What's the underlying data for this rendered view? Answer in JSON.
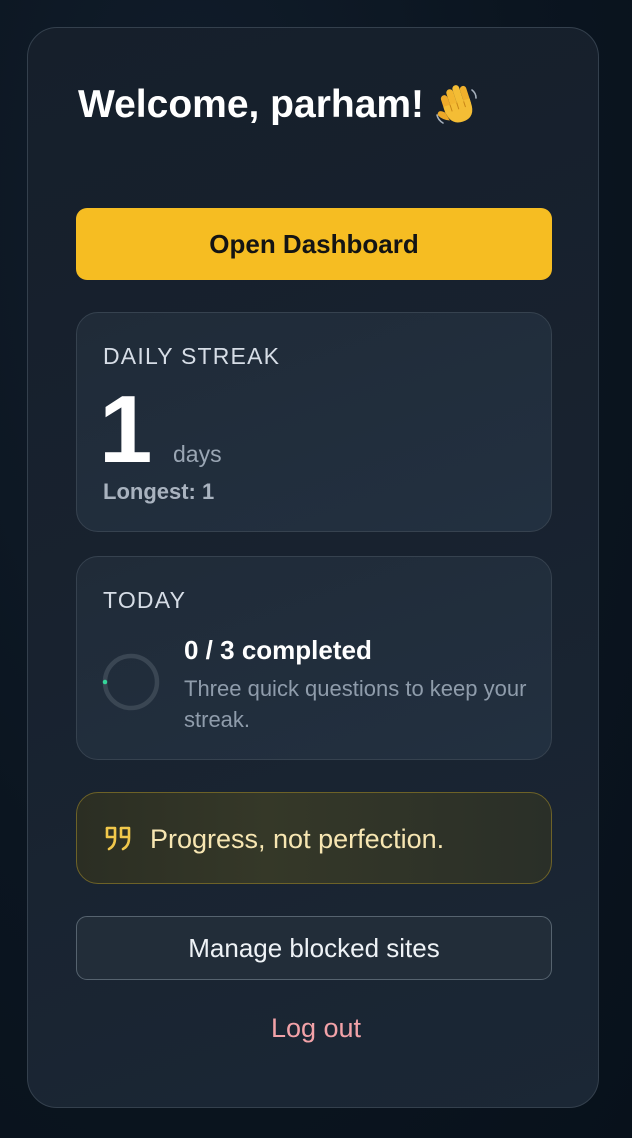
{
  "header": {
    "welcome_text": "Welcome, parham!",
    "wave_icon": "waving-hand-icon"
  },
  "actions": {
    "open_dashboard_label": "Open Dashboard",
    "manage_blocked_sites_label": "Manage blocked sites",
    "logout_label": "Log out"
  },
  "streak": {
    "label": "DAILY STREAK",
    "count": "1",
    "unit": "days",
    "longest_text": "Longest: 1"
  },
  "today": {
    "label": "TODAY",
    "completed": 0,
    "total": 3,
    "progress_fraction": 0,
    "status_text": "0 / 3 completed",
    "description": "Three quick questions to keep your streak."
  },
  "quote": {
    "icon": "quote-icon",
    "text": "Progress, not perfection."
  },
  "colors": {
    "accent": "#f6bd22",
    "progress_dot": "#35d49a",
    "logout": "#f2a2a8",
    "quote_text": "#f7e6b2"
  }
}
